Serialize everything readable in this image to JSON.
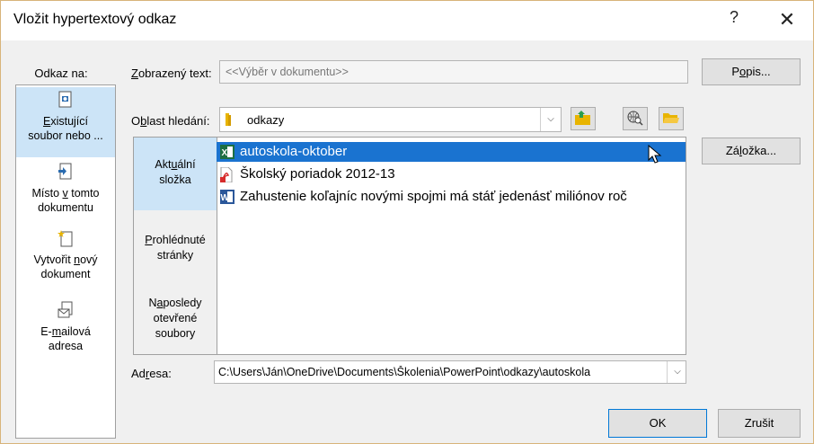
{
  "dialog": {
    "title": "Vložit hypertextový odkaz",
    "help": "?",
    "close": "✕"
  },
  "link_to": {
    "label": "Odkaz na:",
    "items": [
      {
        "label_u": "E",
        "label_rest": "xistující",
        "label2": "soubor nebo ..."
      },
      {
        "label_pre": "Místo ",
        "label_u": "v",
        "label_rest": " tomto",
        "label2": "dokumentu"
      },
      {
        "label_pre": "Vytvořit ",
        "label_u": "n",
        "label_rest": "ový",
        "label2": "dokument"
      },
      {
        "label1": "E-",
        "label_u": "m",
        "label_rest": "ailová",
        "label2": "adresa"
      }
    ]
  },
  "display_text": {
    "label_u": "Z",
    "label_rest": "obrazený text:",
    "value": "<<Výběr v dokumentu>>"
  },
  "tooltip_button": {
    "pre": "P",
    "u": "o",
    "rest": "pis..."
  },
  "look_in": {
    "label_pre": "O",
    "label_u": "b",
    "label_rest": "last hledání:",
    "value": "odkazy"
  },
  "bookmark_button": {
    "pre": "Zá",
    "u": "l",
    "rest": "ožka..."
  },
  "browse_tabs": [
    {
      "pre": "Akt",
      "u": "u",
      "rest": "ální",
      "line2": "složka"
    },
    {
      "u": "P",
      "rest": "rohlédnuté",
      "line2": "stránky"
    },
    {
      "pre": "N",
      "u": "a",
      "rest": "posledy",
      "line2": "otevřené",
      "line3": "soubory"
    }
  ],
  "files": [
    {
      "name": "autoskola-oktober",
      "icon": "excel-icon",
      "selected": true
    },
    {
      "name": "Školský poriadok 2012-13",
      "icon": "pdf-icon",
      "selected": false
    },
    {
      "name": "Zahustenie koľajníc novými spojmi má stáť jedenásť miliónov roč",
      "icon": "word-icon",
      "selected": false
    }
  ],
  "address": {
    "label_pre": "Ad",
    "label_u": "r",
    "label_rest": "esa:",
    "value": "C:\\Users\\Ján\\OneDrive\\Documents\\Školenia\\PowerPoint\\odkazy\\autoskola"
  },
  "ok_label": "OK",
  "cancel_label": "Zrušit",
  "colors": {
    "accent": "#1a73d0",
    "selection_light": "#cce4f7"
  }
}
